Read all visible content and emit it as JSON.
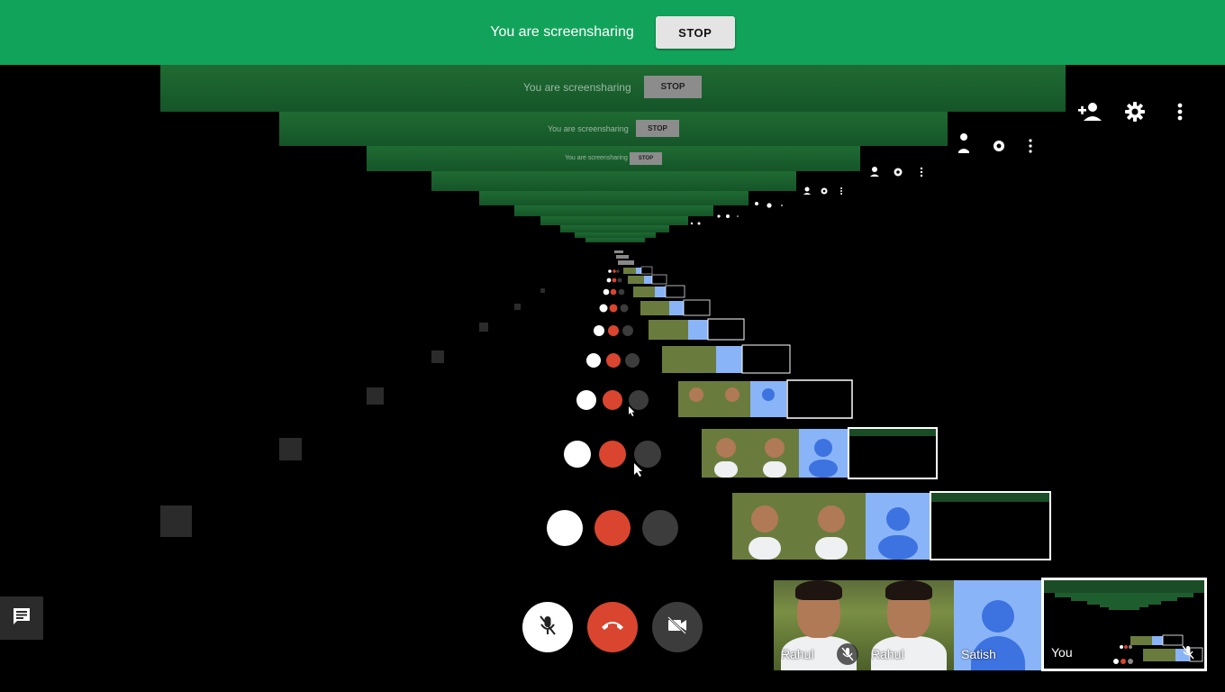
{
  "banner": {
    "message": "You are screensharing",
    "stop_label": "STOP",
    "color": "#12a35a"
  },
  "top_actions": [
    {
      "name": "add-person-icon"
    },
    {
      "name": "gear-icon"
    },
    {
      "name": "more-vert-icon"
    }
  ],
  "chat": {
    "icon": "chat-icon"
  },
  "controls": {
    "mic": {
      "icon": "mic-off-icon",
      "color": "#ffffff"
    },
    "hangup": {
      "icon": "call-end-icon",
      "color": "#d9452f"
    },
    "camera": {
      "icon": "videocam-off-icon",
      "color": "#3c3c3c"
    }
  },
  "participants": [
    {
      "name": "Rahul",
      "muted": true,
      "kind": "photo"
    },
    {
      "name": "Rahul",
      "muted": false,
      "kind": "photo"
    },
    {
      "name": "Satish",
      "muted": false,
      "kind": "avatar"
    },
    {
      "name": "You",
      "muted": true,
      "kind": "self"
    }
  ]
}
